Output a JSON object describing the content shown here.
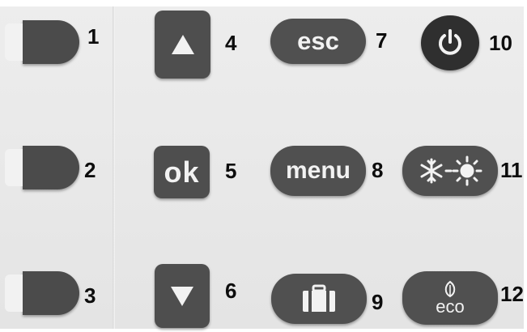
{
  "buttons": [
    {
      "number": "1",
      "icon": "blank-key"
    },
    {
      "number": "2",
      "icon": "blank-key"
    },
    {
      "number": "3",
      "icon": "blank-key"
    },
    {
      "number": "4",
      "icon": "up-arrow-icon"
    },
    {
      "number": "5",
      "label": "ok"
    },
    {
      "number": "6",
      "icon": "down-arrow-icon"
    },
    {
      "number": "7",
      "label": "esc"
    },
    {
      "number": "8",
      "label": "menu"
    },
    {
      "number": "9",
      "icon": "suitcase-icon"
    },
    {
      "number": "10",
      "icon": "power-icon"
    },
    {
      "number": "11",
      "icon": "snowflake-sun-icon"
    },
    {
      "number": "12",
      "label": "eco",
      "icon": "leaf-icon"
    }
  ],
  "colors": {
    "panel": "#e8e8e8",
    "button": "#4e4e4e",
    "power_button": "#2f2f2f",
    "button_text": "#f2f2f2",
    "number_text": "#0d0d0d"
  }
}
